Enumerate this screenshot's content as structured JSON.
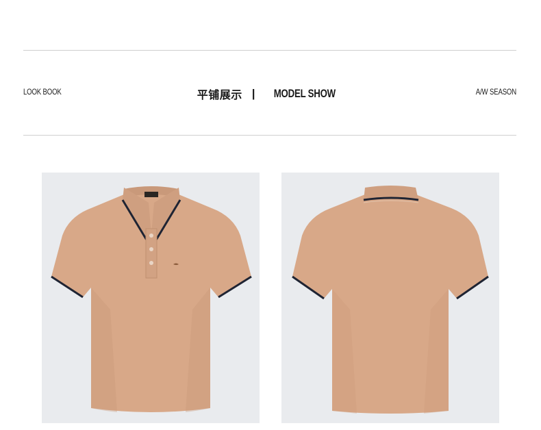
{
  "header": {
    "left_label": "LOOK BOOK",
    "center_cn": "平铺展示",
    "separator": "|",
    "center_en": "MODEL SHOW",
    "right_label": "A/W SEASON"
  },
  "colors": {
    "background": "#ffffff",
    "rule": "#cfcfcf",
    "photo_bg": "#e9ebee",
    "shirt": "#d8a888",
    "trim": "#1f2433"
  },
  "photos": [
    {
      "view": "front"
    },
    {
      "view": "back"
    }
  ]
}
